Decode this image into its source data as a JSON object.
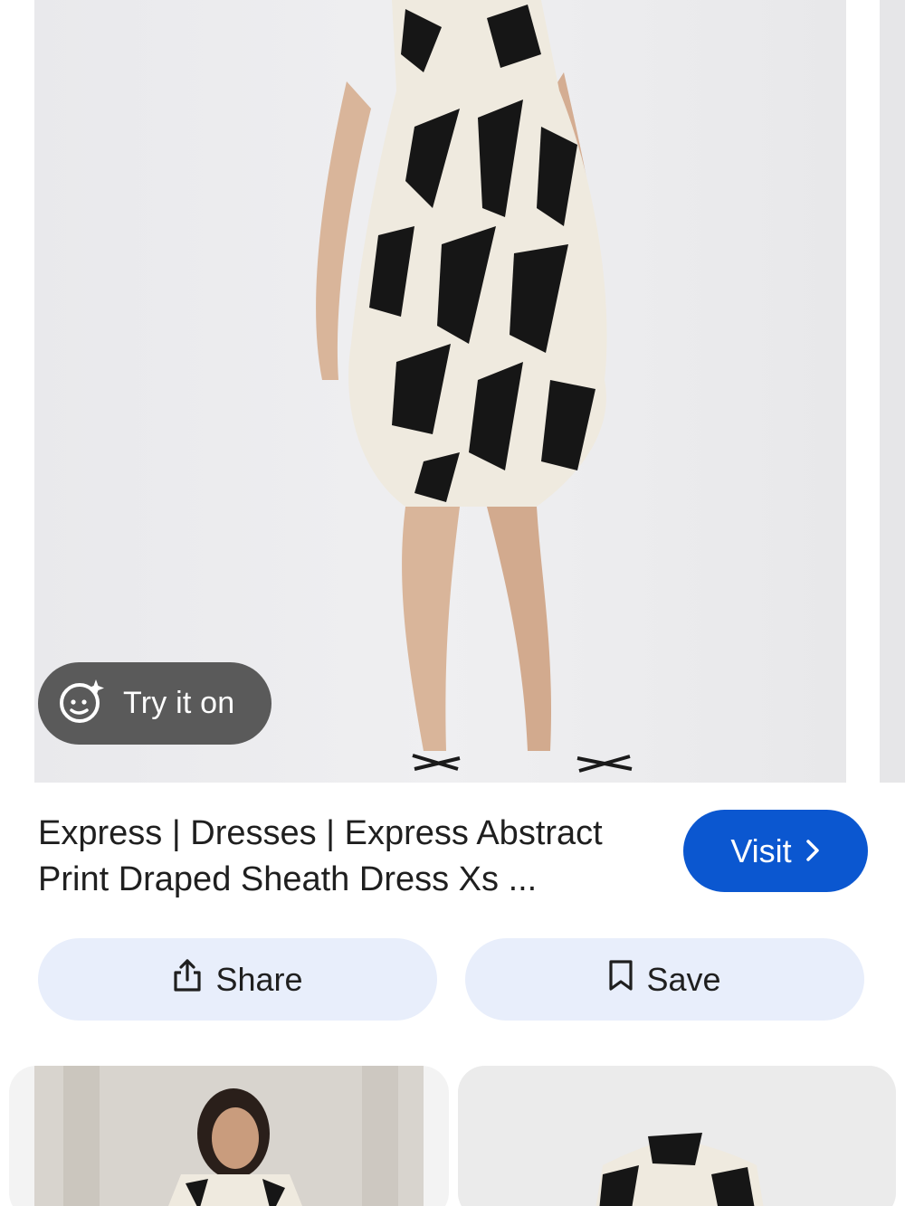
{
  "hero": {
    "image_alt": "Model wearing a black and cream abstract print draped sheath dress",
    "try_on_label": "Try it on"
  },
  "product": {
    "title": "Express | Dresses | Express Abstract Print Draped Sheath Dress Xs ...",
    "visit_label": "Visit"
  },
  "actions": {
    "share_label": "Share",
    "save_label": "Save"
  },
  "related": [
    {
      "image_alt": "Woman in abstract print dress"
    },
    {
      "image_alt": "Abstract print dress on mannequin"
    }
  ],
  "colors": {
    "accent": "#0b57d0",
    "action_bg": "#e8eefb",
    "pill_bg": "#464646"
  }
}
